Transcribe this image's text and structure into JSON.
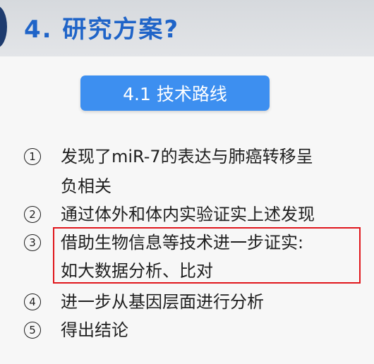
{
  "header": {
    "title": "4. 研究方案?"
  },
  "section": {
    "subtitle": "4.1 技术路线"
  },
  "items": [
    {
      "number": "1",
      "line1": "发现了miR-7的表达与肺癌转移呈",
      "line2": "负相关"
    },
    {
      "number": "2",
      "line1": "通过体外和体内实验证实上述发现"
    },
    {
      "number": "3",
      "line1": "借助生物信息等技术进一步证实:",
      "line2": "如大数据分析、比对"
    },
    {
      "number": "4",
      "line1": "进一步从基因层面进行分析"
    },
    {
      "number": "5",
      "line1": "得出结论"
    }
  ],
  "colors": {
    "title": "#1f64c8",
    "pill": "#3d8ff0",
    "highlight_border": "#e0161c"
  }
}
